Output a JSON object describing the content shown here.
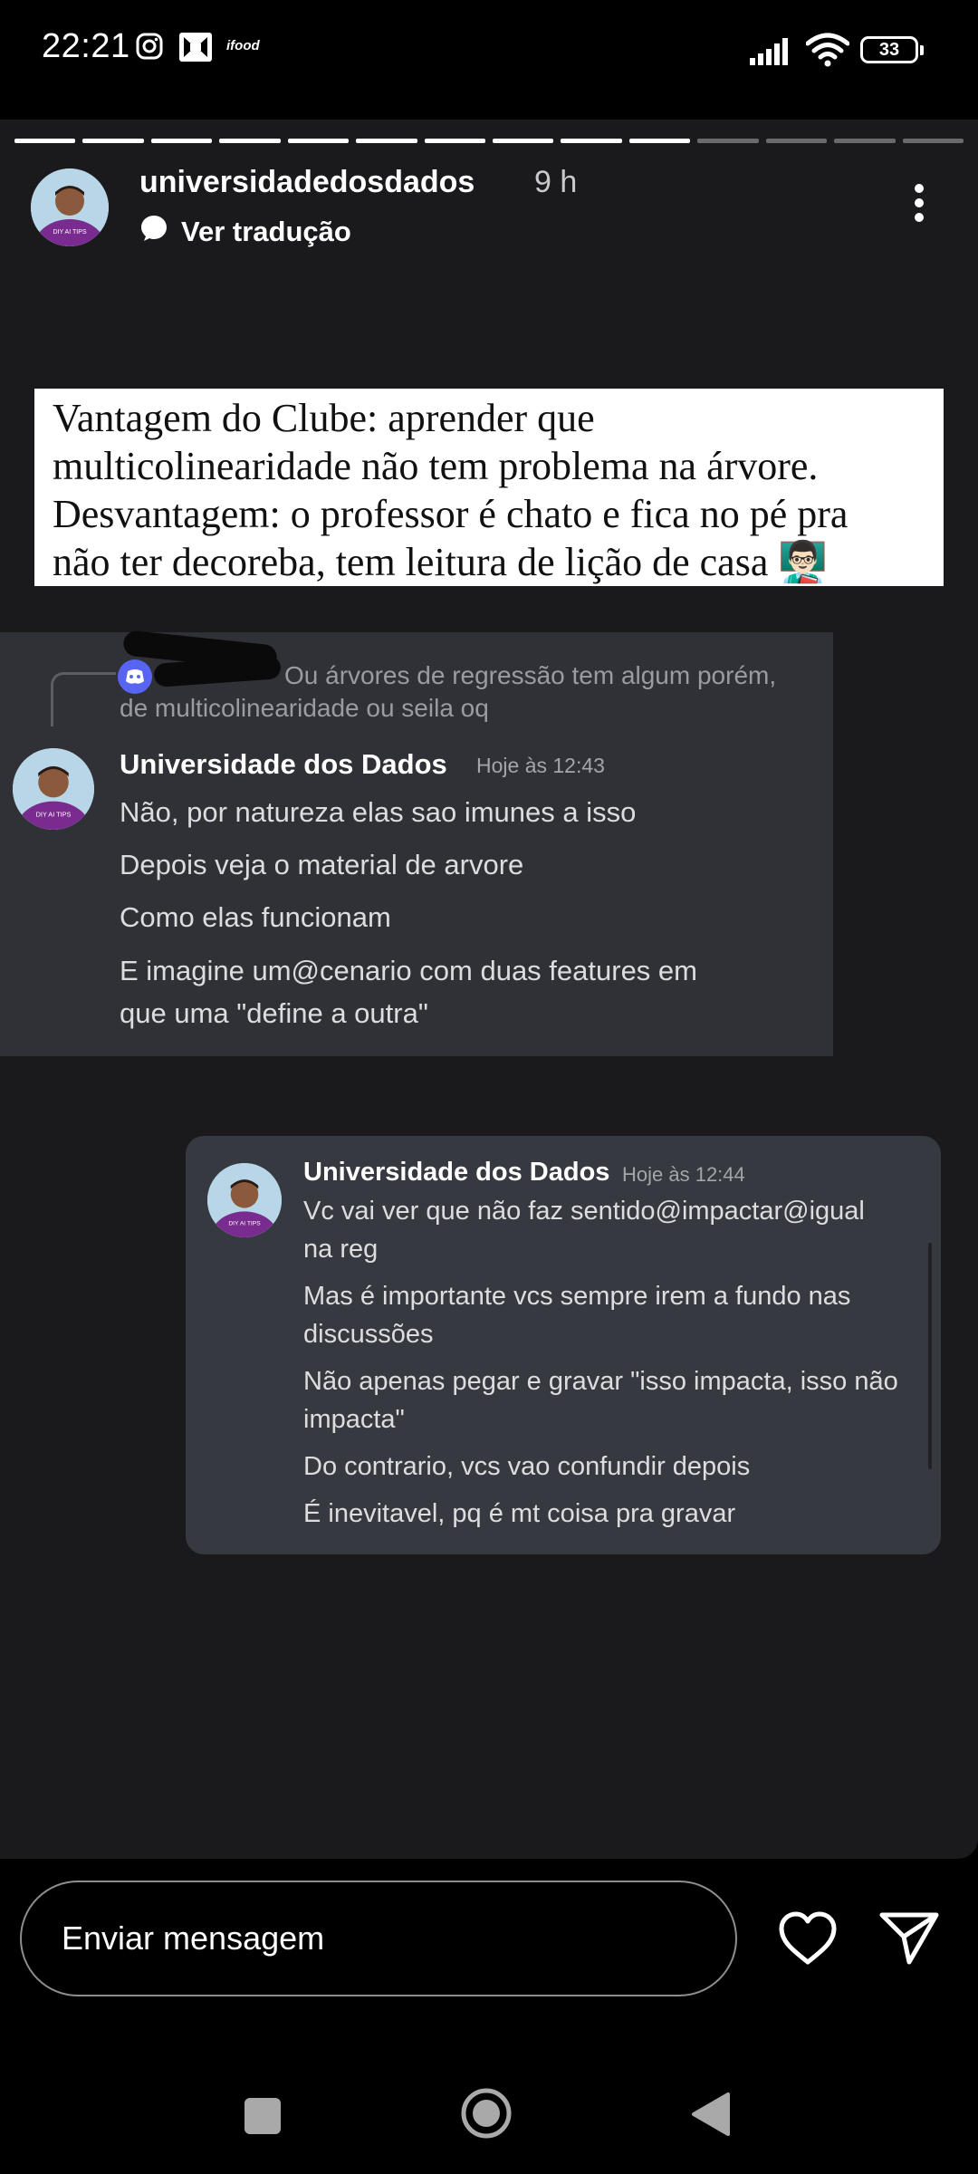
{
  "status_bar": {
    "time": "22:21",
    "notification_icons": [
      "instagram-icon",
      "app-icon",
      "ifood-icon"
    ],
    "ifood_label": "ifood",
    "battery": "33"
  },
  "story": {
    "progress_total": 14,
    "progress_seen": 10,
    "username": "universidadedosdados",
    "age": "9 h",
    "translate_label": "Ver tradução",
    "sticker_lines": [
      "Vantagem do Clube: aprender que",
      "multicolinearidade não tem problema na árvore.",
      "Desvantagem: o professor é chato e fica no pé pra",
      "não ter decoreba, tem leitura de lição de casa 👨🏻‍🏫"
    ]
  },
  "card1": {
    "reply_text_line1": "Ou árvores de regressão tem algum porém,",
    "reply_text_line2": "de multicolinearidade ou seila oq",
    "author": "Universidade dos Dados",
    "timestamp": "Hoje às 12:43",
    "lines": [
      "Não, por natureza elas sao imunes a isso",
      "Depois veja o material de arvore",
      "Como elas funcionam",
      "E imagine um@cenario com duas features em",
      "que uma \"define a outra\""
    ]
  },
  "card2": {
    "author": "Universidade dos Dados",
    "timestamp": "Hoje às 12:44",
    "lines": [
      "Vc vai ver que não faz sentido@impactar@igual",
      "na reg",
      "Mas é importante vcs sempre irem a fundo nas",
      "discussões",
      "Não apenas pegar e gravar \"isso impacta, isso não",
      "impacta\"",
      "Do contrario, vcs vao confundir depois",
      "É inevitavel, pq é mt coisa pra gravar"
    ]
  },
  "bottom_bar": {
    "message_placeholder": "Enviar mensagem"
  },
  "colors": {
    "story_bg": "#1a1a1c",
    "discord_card_bg": "#2f3136",
    "discord_blurple": "#5865f2"
  }
}
